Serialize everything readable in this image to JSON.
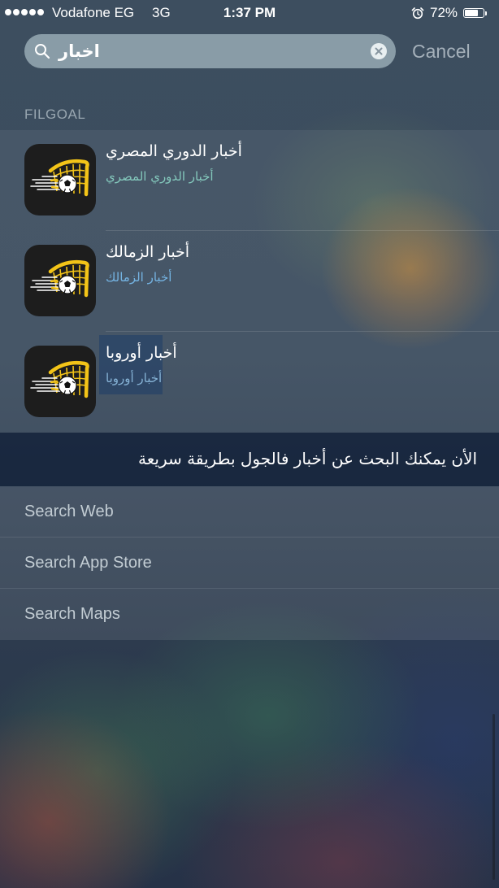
{
  "status_bar": {
    "carrier": "Vodafone EG",
    "network": "3G",
    "signal_bars": 5,
    "time": "1:37 PM",
    "battery_text": "72%",
    "battery_level": 0.72
  },
  "search": {
    "query": "اخبار",
    "cancel_label": "Cancel"
  },
  "section": {
    "title": "FILGOAL"
  },
  "results": [
    {
      "title": "أخبار الدوري المصري",
      "subtitle": "أخبار الدوري المصري",
      "icon": "filgoal-app-icon"
    },
    {
      "title": "أخبار الزمالك",
      "subtitle": "أخبار الزمالك",
      "icon": "filgoal-app-icon"
    },
    {
      "title": "أخبار أوروبا",
      "subtitle": "أخبار أوروبا",
      "icon": "filgoal-app-icon"
    }
  ],
  "banner": {
    "text": "الأن يمكنك البحث عن أخبار فالجول بطريقة سريعة"
  },
  "suggestions": [
    {
      "label": "Search Web"
    },
    {
      "label": "Search App Store"
    },
    {
      "label": "Search Maps"
    }
  ],
  "icons": {
    "search": "search-icon",
    "clear": "clear-icon",
    "alarm": "alarm-icon",
    "battery": "battery-icon",
    "app": "filgoal-app-icon"
  },
  "colors": {
    "app_icon_background": "#1d1d1d",
    "app_icon_yellow": "#f3c418",
    "banner_background": "#081630"
  }
}
